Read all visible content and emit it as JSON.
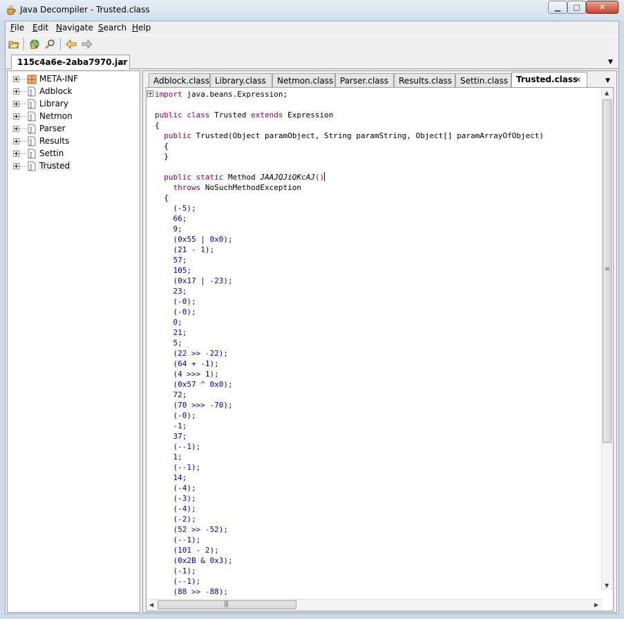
{
  "window": {
    "title": "Java Decompiler - Trusted.class"
  },
  "menu": {
    "items": [
      {
        "label": "File",
        "mnemonic": "F",
        "rest": "ile"
      },
      {
        "label": "Edit",
        "mnemonic": "E",
        "rest": "dit"
      },
      {
        "label": "Navigate",
        "mnemonic": "N",
        "rest": "avigate"
      },
      {
        "label": "Search",
        "mnemonic": "S",
        "rest": "earch"
      },
      {
        "label": "Help",
        "mnemonic": "H",
        "rest": "elp"
      }
    ]
  },
  "toolbar": {
    "icons": [
      "open-folder-icon",
      "open-type-icon",
      "search-icon",
      "back-arrow-icon",
      "forward-arrow-icon"
    ]
  },
  "file_tab": {
    "label": "115c4a6e-2aba7970.jar"
  },
  "tree": {
    "nodes": [
      {
        "label": "META-INF",
        "icon": "package-icon"
      },
      {
        "label": "Adblock",
        "icon": "java-file-icon"
      },
      {
        "label": "Library",
        "icon": "java-file-icon"
      },
      {
        "label": "Netmon",
        "icon": "java-file-icon"
      },
      {
        "label": "Parser",
        "icon": "java-file-icon"
      },
      {
        "label": "Results",
        "icon": "java-file-icon"
      },
      {
        "label": "Settin",
        "icon": "java-file-icon"
      },
      {
        "label": "Trusted",
        "icon": "java-file-icon",
        "selected": true
      }
    ]
  },
  "class_tabs": [
    {
      "label": "Adblock.class"
    },
    {
      "label": "Library.class"
    },
    {
      "label": "Netmon.class"
    },
    {
      "label": "Parser.class"
    },
    {
      "label": "Results.class"
    },
    {
      "label": "Settin.class"
    },
    {
      "label": "Trusted.class",
      "active": true
    }
  ],
  "code": {
    "import_line": "import java.beans.Expression;",
    "class_decl": "public class Trusted extends Expression",
    "constructor": "public Trusted(Object paramObject, String paramString, Object[] paramArrayOfObject)",
    "method_decl": "public static Method JAAJQJiQKcAJ()",
    "throws_line": "throws NoSuchMethodException",
    "statements": [
      "(-5);",
      "66;",
      "9;",
      "(0x55 | 0x0);",
      "(21 - 1);",
      "57;",
      "105;",
      "(0x17 | -23);",
      "23;",
      "(-0);",
      "(-0);",
      "0;",
      "21;",
      "5;",
      "(22 >> -22);",
      "(64 + -1);",
      "(4 >>> 1);",
      "(0x57 ^ 0x0);",
      "72;",
      "(70 >>> -70);",
      "(-0);",
      "-1;",
      "37;",
      "(--1);",
      "1;",
      "(--1);",
      "14;",
      "(-4);",
      "(-3);",
      "(-4);",
      "(-2);",
      "(52 >> -52);",
      "(--1);",
      "(101 - 2);",
      "(0x2B & 0x3);",
      "(-1);",
      "(--1);",
      "(88 >> -88);"
    ]
  },
  "colors": {
    "keyword": "#7f0055",
    "number": "#0000c0",
    "title_bar": "#d3dfec"
  }
}
